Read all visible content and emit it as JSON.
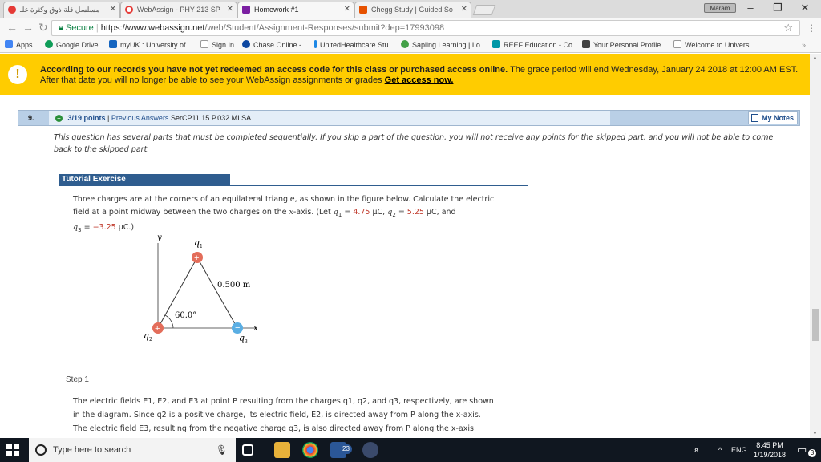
{
  "browser": {
    "tabs": [
      {
        "label": "مسلسل قلة ذوق وكثرة غلـ",
        "icon_color": "#e53935"
      },
      {
        "label": "WebAssign - PHY 213 SP",
        "icon_color": "#e53935"
      },
      {
        "label": "Homework #1",
        "icon_color": "#7b1fa2"
      },
      {
        "label": "Chegg Study | Guided So",
        "icon_color": "#e65100"
      }
    ],
    "profile": "Maram",
    "address": {
      "secure_label": "Secure",
      "host": "https://www.webassign.net",
      "path": "/web/Student/Assignment-Responses/submit?dep=17993098"
    },
    "bookmarks": [
      {
        "label": "Apps",
        "color": "#4285f4"
      },
      {
        "label": "Google Drive",
        "color": "#0f9d58"
      },
      {
        "label": "myUK : University of",
        "color": "#1565c0"
      },
      {
        "label": "Sign In",
        "color": "#9e9e9e"
      },
      {
        "label": "Chase Online -",
        "color": "#0d47a1"
      },
      {
        "label": "UnitedHealthcare Stu",
        "color": "#1e88e5"
      },
      {
        "label": "Sapling Learning | Lo",
        "color": "#43a047"
      },
      {
        "label": "REEF Education - Co",
        "color": "#0097a7"
      },
      {
        "label": "Your Personal Profile",
        "color": "#424242"
      },
      {
        "label": "Welcome to Universi",
        "color": "#9e9e9e"
      }
    ]
  },
  "banner": {
    "bold": "According to our records you have not yet redeemed an access code for this class or purchased access online.",
    "text": "The grace period will end Wednesday, January 24 2018 at 12:00 AM EST. After that date you will no longer be able to see your WebAssign assignments or grades",
    "link": "Get access now."
  },
  "question": {
    "number": "9.",
    "points": "3/19 points",
    "separator": "|",
    "previous": "Previous Answers",
    "code": "SerCP11 15.P.032.MI.SA.",
    "my_notes": "My Notes",
    "note": "This question has several parts that must be completed sequentially. If you skip a part of the question, you will not receive any points for the skipped part, and you will not be able to come back to the skipped part.",
    "tutorial_title": "Tutorial Exercise",
    "problem_line1": "Three charges are at the corners of an equilateral triangle, as shown in the figure below. Calculate the electric",
    "problem_line2a": "field at a point midway between the two charges on the ",
    "x_axis": "x",
    "problem_line2b": "-axis. (Let ",
    "q1": "q",
    "q1_sub": "1",
    "eq": " = ",
    "q1_val": "4.75",
    "unit": " μC, ",
    "q2_val": "5.25",
    "q3_val": "−3.25",
    "unit_end": " μC.)",
    "and": "and"
  },
  "figure": {
    "y_label": "y",
    "x_label": "x",
    "q1_label": "q",
    "q1_sub": "1",
    "q2_label": "q",
    "q2_sub": "2",
    "q3_label": "q",
    "q3_sub": "3",
    "side_label": "0.500 m",
    "angle_label": "60.0°",
    "plus": "+",
    "minus": "−"
  },
  "step": {
    "title": "Step 1",
    "line1": "The electric fields E1, E2, and E3 at point P resulting from the charges q1, q2, and q3, respectively, are shown",
    "line2": "in the diagram. Since q2 is a positive charge, its electric field, E2, is directed away from P along the x-axis.",
    "line3": "The electric field E3, resulting from the negative charge q3, is also directed away from P along the x-axis"
  },
  "taskbar": {
    "search_placeholder": "Type here to search",
    "badge": "23",
    "lang": "ENG",
    "time": "8:45 PM",
    "date": "1/19/2018",
    "notify_count": "3"
  }
}
